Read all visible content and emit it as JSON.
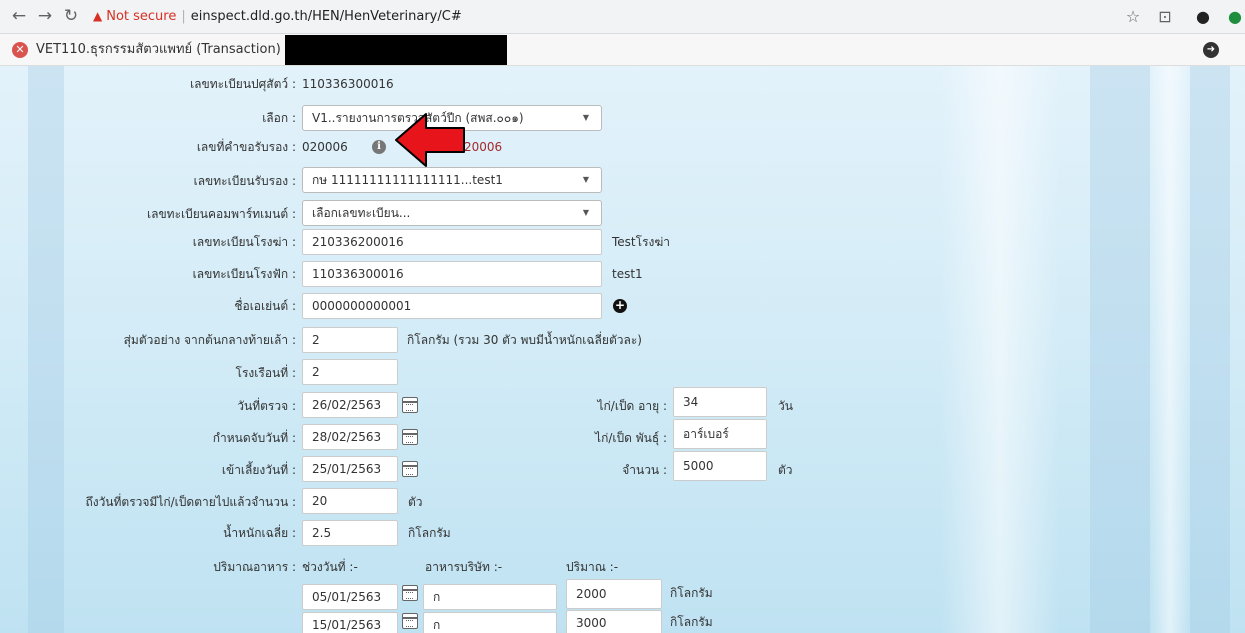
{
  "browser": {
    "not_secure": "Not secure",
    "url": "einspect.dld.go.th/HEN/HenVeterinary/C#"
  },
  "window": {
    "title": "VET110.ธุรกรรมสัตวแพทย์ (Transaction)"
  },
  "form": {
    "registration": {
      "label": "เลขทะเบียนปศุสัตว์ :",
      "value": "110336300016"
    },
    "choose": {
      "label": "เลือก :",
      "value": "V1..รายงานการตรวจสัตว์ปีก (สพส.๐๐๑)"
    },
    "cert_request": {
      "label": "เลขที่คำขอรับรอง :",
      "value": "020006",
      "hint": "20006"
    },
    "cert_registration": {
      "label": "เลขทะเบียนรับรอง :",
      "value": "กษ 11111111111111111...test1"
    },
    "compartment": {
      "label": "เลขทะเบียนคอมพาร์ทเมนต์ :",
      "value": "เลือกเลขทะเบียน..."
    },
    "slaughterhouse": {
      "label": "เลขทะเบียนโรงฆ่า :",
      "value": "210336200016",
      "note": "Testโรงฆ่า"
    },
    "hatchery": {
      "label": "เลขทะเบียนโรงฟัก :",
      "value": "110336300016",
      "note": "test1"
    },
    "agent": {
      "label": "ชื่อเอเย่นต์ :",
      "value": "0000000000001"
    },
    "sample": {
      "label": "สุ่มตัวอย่าง จากต้นกลางท้ายเล้า :",
      "value": "2",
      "note": "กิโลกรัม  (รวม 30 ตัว พบมีน้ำหนักเฉลี่ยตัวละ)"
    },
    "house": {
      "label": "โรงเรือนที่ :",
      "value": "2"
    },
    "inspect_date": {
      "label": "วันที่ตรวจ :",
      "value": "26/02/2563"
    },
    "catch_date": {
      "label": "กำหนดจับวันที่ :",
      "value": "28/02/2563"
    },
    "raise_date": {
      "label": "เข้าเลี้ยงวันที่ :",
      "value": "25/01/2563"
    },
    "age": {
      "label": "ไก่/เป็ด อายุ :",
      "value": "34",
      "unit": "วัน"
    },
    "breed": {
      "label": "ไก่/เป็ด พันธุ์ :",
      "value": "อาร์เบอร์"
    },
    "count": {
      "label": "จำนวน :",
      "value": "5000",
      "unit": "ตัว"
    },
    "dead": {
      "label": "ถึงวันที่ตรวจมีไก่/เป็ดตายไปแล้วจำนวน :",
      "value": "20",
      "unit": "ตัว"
    },
    "avg_weight": {
      "label": "น้ำหนักเฉลี่ย :",
      "value": "2.5",
      "unit": "กิโลกรัม"
    },
    "feed": {
      "label": "ปริมาณอาหาร :",
      "col_date": "ช่วงวันที่ :-",
      "col_company": "อาหารบริษัท :-",
      "col_amount": "ปริมาณ :-",
      "rows": [
        {
          "date": "05/01/2563",
          "company": "ก",
          "amount": "2000",
          "unit": "กิโลกรัม"
        },
        {
          "date": "15/01/2563",
          "company": "ก",
          "amount": "3000",
          "unit": "กิโลกรัม"
        }
      ]
    }
  }
}
